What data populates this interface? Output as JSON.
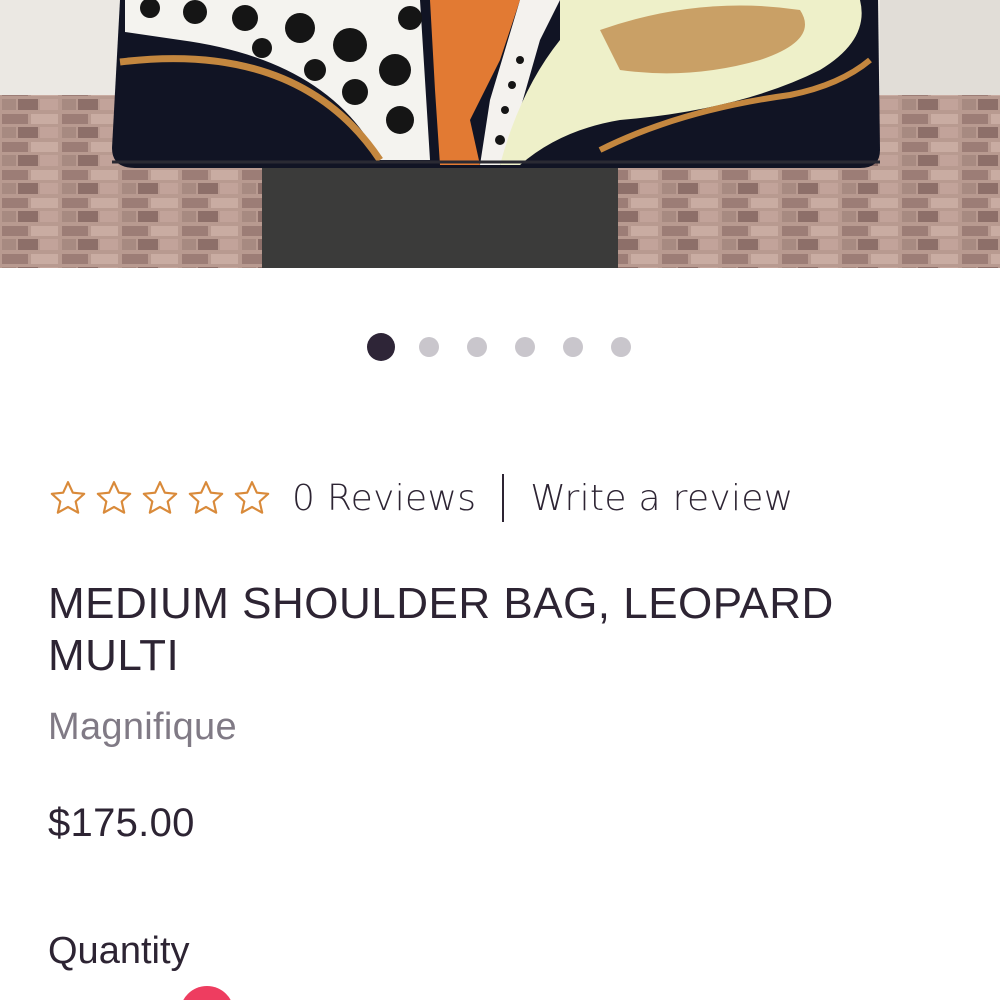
{
  "product": {
    "image_alt": "Hand-painted medium shoulder bag with leopard pattern",
    "carousel": {
      "total": 6,
      "active_index": 0
    },
    "rating": {
      "stars_filled": 0,
      "stars_total": 5
    },
    "reviews_text": "0 Reviews",
    "write_review_label": "Write a review",
    "title": "MEDIUM SHOULDER BAG, LEOPARD MULTI",
    "brand": "Magnifique",
    "price": "$175.00",
    "quantity_label": "Quantity"
  },
  "colors": {
    "star_outline": "#d98a3a",
    "text_primary": "#2d2433",
    "text_muted": "#807a85",
    "dot_active": "#2e2537",
    "dot_inactive": "#c9c6cc",
    "badge": "#ee3d60"
  },
  "icons": {
    "star": "star-outline-icon"
  }
}
